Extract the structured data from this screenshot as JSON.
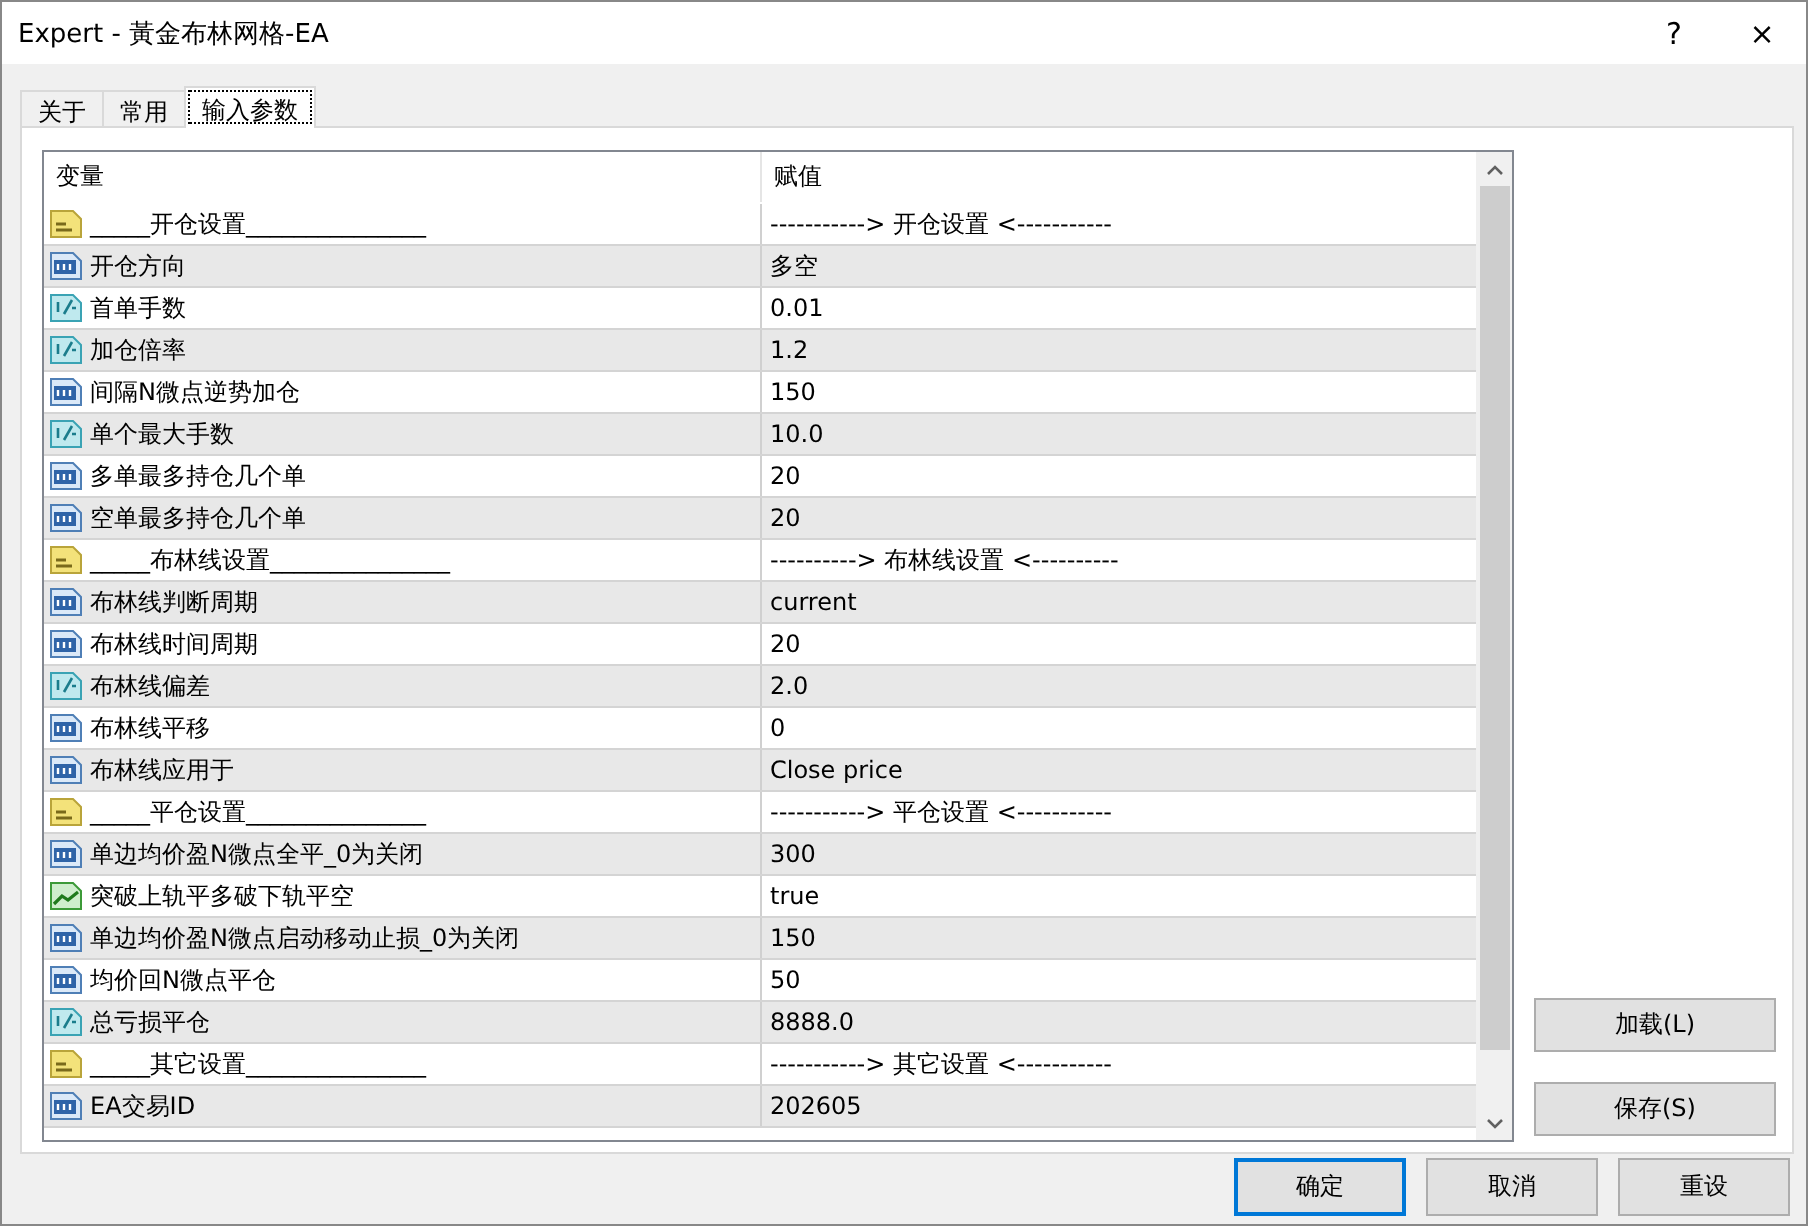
{
  "window": {
    "title": "Expert - 黃金布林网格-EA",
    "help": "?",
    "close": "×"
  },
  "tabs": [
    {
      "label": "关于",
      "selected": false
    },
    {
      "label": "常用",
      "selected": false
    },
    {
      "label": "输入参数",
      "selected": true
    }
  ],
  "table": {
    "columns": [
      "变量",
      "赋值"
    ],
    "rows": [
      {
        "kind": "string",
        "name": "_____开仓设置_______________",
        "value": "-----------> 开仓设置 <-----------"
      },
      {
        "kind": "int",
        "name": "开仓方向",
        "value": "多空"
      },
      {
        "kind": "double",
        "name": "首单手数",
        "value": "0.01"
      },
      {
        "kind": "double",
        "name": "加仓倍率",
        "value": "1.2"
      },
      {
        "kind": "int",
        "name": "间隔N微点逆势加仓",
        "value": "150"
      },
      {
        "kind": "double",
        "name": "单个最大手数",
        "value": "10.0"
      },
      {
        "kind": "int",
        "name": "多单最多持仓几个单",
        "value": "20"
      },
      {
        "kind": "int",
        "name": "空单最多持仓几个单",
        "value": "20"
      },
      {
        "kind": "string",
        "name": "_____布林线设置_______________",
        "value": "----------> 布林线设置 <----------"
      },
      {
        "kind": "int",
        "name": "布林线判断周期",
        "value": "current"
      },
      {
        "kind": "int",
        "name": "布林线时间周期",
        "value": "20"
      },
      {
        "kind": "double",
        "name": "布林线偏差",
        "value": "2.0"
      },
      {
        "kind": "int",
        "name": "布林线平移",
        "value": "0"
      },
      {
        "kind": "int",
        "name": "布林线应用于",
        "value": "Close price"
      },
      {
        "kind": "string",
        "name": "_____平仓设置_______________",
        "value": "-----------> 平仓设置 <-----------"
      },
      {
        "kind": "int",
        "name": "单边均价盈N微点全平_0为关闭",
        "value": "300"
      },
      {
        "kind": "bool",
        "name": "突破上轨平多破下轨平空",
        "value": "true"
      },
      {
        "kind": "int",
        "name": "单边均价盈N微点启动移动止损_0为关闭",
        "value": "150"
      },
      {
        "kind": "int",
        "name": "均价回N微点平仓",
        "value": "50"
      },
      {
        "kind": "double",
        "name": "总亏损平仓",
        "value": "8888.0"
      },
      {
        "kind": "string",
        "name": "_____其它设置_______________",
        "value": "-----------> 其它设置 <-----------"
      },
      {
        "kind": "int",
        "name": "EA交易ID",
        "value": "202605"
      }
    ]
  },
  "side_buttons": [
    "加载(L)",
    "保存(S)"
  ],
  "buttons": [
    {
      "label": "确定",
      "default": true
    },
    {
      "label": "取消",
      "default": false
    },
    {
      "label": "重设",
      "default": false
    }
  ]
}
